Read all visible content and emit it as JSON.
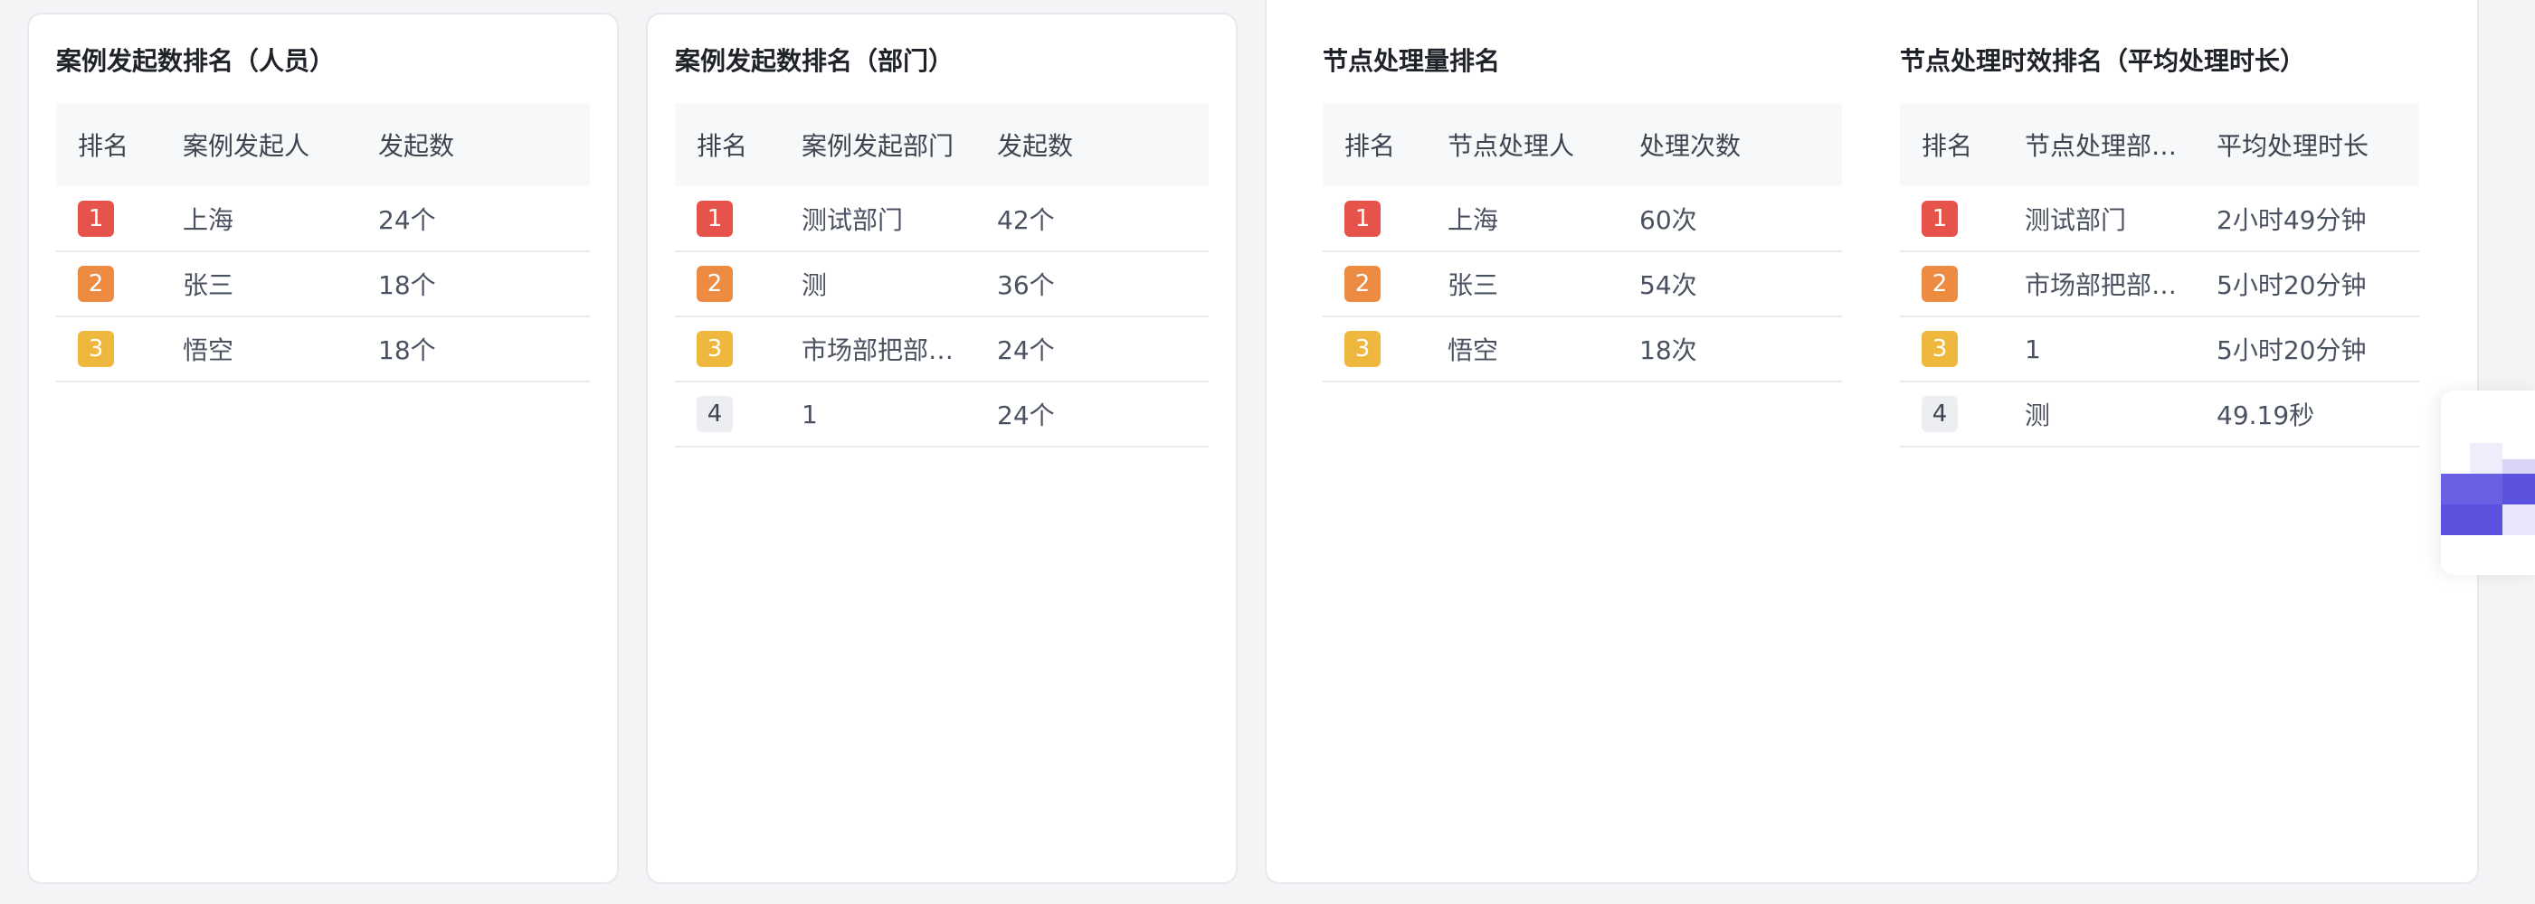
{
  "colors": {
    "rank_1": "#e5534b",
    "rank_2": "#ed8b43",
    "rank_3": "#eeb73e",
    "rank_other": "#eceef2",
    "widget_accent": "#5b52e0"
  },
  "panels": [
    {
      "title": "案例发起数排名（人员）",
      "headers": [
        "排名",
        "案例发起人",
        "发起数"
      ],
      "rows": [
        {
          "rank": "1",
          "name": "上海",
          "value": "24个"
        },
        {
          "rank": "2",
          "name": "张三",
          "value": "18个"
        },
        {
          "rank": "3",
          "name": "悟空",
          "value": "18个"
        }
      ]
    },
    {
      "title": "案例发起数排名（部门）",
      "headers": [
        "排名",
        "案例发起部门",
        "发起数"
      ],
      "rows": [
        {
          "rank": "1",
          "name": "测试部门",
          "value": "42个"
        },
        {
          "rank": "2",
          "name": "测",
          "value": "36个"
        },
        {
          "rank": "3",
          "name": "市场部把部…",
          "value": "24个"
        },
        {
          "rank": "4",
          "name": "1",
          "value": "24个"
        }
      ]
    },
    {
      "title": "节点处理量排名",
      "headers": [
        "排名",
        "节点处理人",
        "处理次数"
      ],
      "rows": [
        {
          "rank": "1",
          "name": "上海",
          "value": "60次"
        },
        {
          "rank": "2",
          "name": "张三",
          "value": "54次"
        },
        {
          "rank": "3",
          "name": "悟空",
          "value": "18次"
        }
      ]
    },
    {
      "title": "节点处理时效排名（平均处理时长）",
      "headers": [
        "排名",
        "节点处理部…",
        "平均处理时长"
      ],
      "rows": [
        {
          "rank": "1",
          "name": "测试部门",
          "value": "2小时49分钟"
        },
        {
          "rank": "2",
          "name": "市场部把部…",
          "value": "5小时20分钟"
        },
        {
          "rank": "3",
          "name": "1",
          "value": "5小时20分钟"
        },
        {
          "rank": "4",
          "name": "测",
          "value": "49.19秒"
        }
      ]
    }
  ],
  "widget": {
    "icon": "pixel-logo-icon"
  }
}
